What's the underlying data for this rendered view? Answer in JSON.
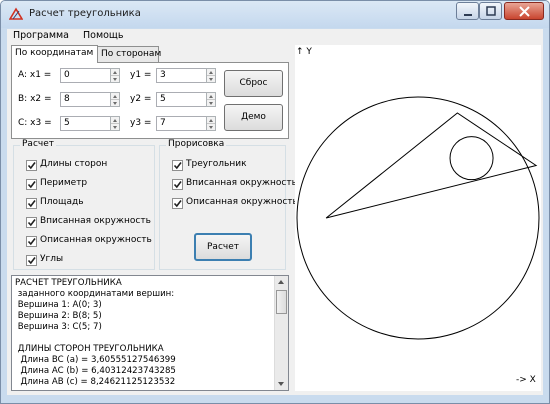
{
  "window": {
    "title": "Расчет треугольника"
  },
  "menu": [
    "Программа",
    "Помощь"
  ],
  "tabs": [
    "По координатам",
    "По сторонам"
  ],
  "coords": [
    {
      "label": "A:  x1 =",
      "x": "0",
      "ylabel": "y1 =",
      "y": "3"
    },
    {
      "label": "B:  x2 =",
      "x": "8",
      "ylabel": "y2 =",
      "y": "5"
    },
    {
      "label": "C:  x3 =",
      "x": "5",
      "ylabel": "y3 =",
      "y": "7"
    }
  ],
  "buttons": {
    "reset": "Сброс",
    "demo": "Демо",
    "calc": "Расчет"
  },
  "calc_group": {
    "title": "Расчет",
    "items": [
      {
        "label": "Длины сторон",
        "checked": true
      },
      {
        "label": "Периметр",
        "checked": true
      },
      {
        "label": "Площадь",
        "checked": true
      },
      {
        "label": "Вписанная окружность",
        "checked": true
      },
      {
        "label": "Описанная окружность",
        "checked": true
      },
      {
        "label": "Углы",
        "checked": true
      }
    ]
  },
  "draw_group": {
    "title": "Прорисовка",
    "items": [
      {
        "label": "Треугольник",
        "checked": true
      },
      {
        "label": "Вписанная окружность",
        "checked": true
      },
      {
        "label": "Описанная окружность",
        "checked": true
      }
    ]
  },
  "output_lines": [
    "РАСЧЕТ ТРЕУГОЛЬНИКА",
    " заданного координатами вершин:",
    " Вершина 1: A(0; 3)",
    " Вершина 2: B(8; 5)",
    " Вершина 3: C(5; 7)",
    "",
    " ДЛИНЫ СТОРОН ТРЕУГОЛЬНИКА",
    "  Длина BC (a) = 3,60555127546399",
    "  Длина AC (b) = 6,40312423743285",
    "  Длина AB (c) = 8,24621125123532"
  ],
  "axes": {
    "y_label": "↑ Y",
    "x_label": "-> X"
  },
  "geometry": {
    "triangle": [
      [
        0,
        3
      ],
      [
        8,
        5
      ],
      [
        5,
        7
      ]
    ],
    "incircle": {
      "cx": 5.54,
      "cy": 5.28,
      "r": 0.82
    },
    "circumcircle": {
      "cx": 3.5,
      "cy": 3.0,
      "r": 4.61
    }
  }
}
